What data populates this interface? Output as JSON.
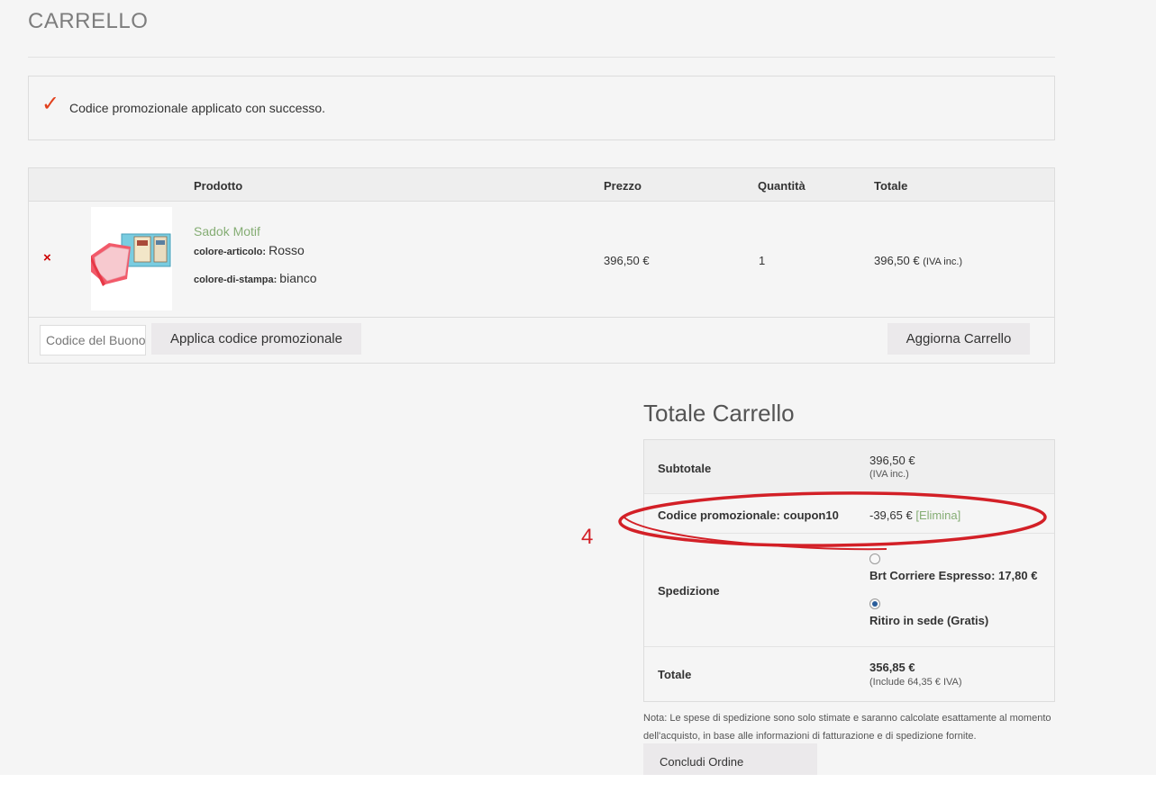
{
  "page": {
    "title": "CARRELLO",
    "notice": "Codice promozionale applicato con successo.",
    "check_icon": "✓"
  },
  "cart": {
    "headers": {
      "product": "Prodotto",
      "price": "Prezzo",
      "quantity": "Quantità",
      "total": "Totale"
    },
    "item": {
      "remove_icon": "×",
      "name": "Sadok Motif",
      "attr1_label": "colore-articolo:",
      "attr1_value": "Rosso",
      "attr2_label": "colore-di-stampa:",
      "attr2_value": "bianco",
      "price": "396,50 €",
      "quantity": "1",
      "total": "396,50 €",
      "total_note": "(IVA inc.)"
    },
    "coupon_placeholder": "Codice del Buono",
    "apply_button": "Applica codice promozionale",
    "update_button": "Aggiorna Carrello"
  },
  "totals": {
    "title": "Totale Carrello",
    "subtotal_label": "Subtotale",
    "subtotal_value": "396,50 €",
    "subtotal_note": "(IVA inc.)",
    "coupon_label": "Codice promozionale: coupon10",
    "coupon_value": "-39,65 €",
    "coupon_remove": "[Elimina]",
    "shipping_label": "Spedizione",
    "shipping_option1": "Brt Corriere Espresso: 17,80 €",
    "shipping_option2": "Ritiro in sede (Gratis)",
    "shipping_selected": "Ritiro in sede (Gratis)",
    "total_label": "Totale",
    "total_value": "356,85 €",
    "total_note": "(Include 64,35 € IVA)",
    "note": "Nota: Le spese di spedizione sono solo stimate e saranno calcolate esattamente al momento dell'acquisto, in base alle informazioni di fatturazione e di spedizione fornite.",
    "checkout_button": "Concludi Ordine"
  },
  "annotation": {
    "number": "4",
    "color": "#d32027"
  },
  "colors": {
    "accent_green": "#85ad74",
    "remove_red": "#cc0000",
    "check_red": "#e2401c"
  }
}
